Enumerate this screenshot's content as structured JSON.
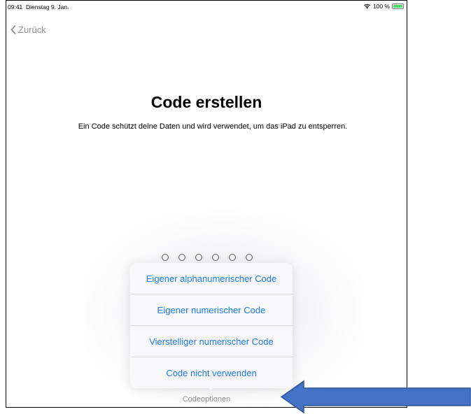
{
  "status_bar": {
    "time": "09:41",
    "date": "Dienstag 9. Jan.",
    "battery": "100 %",
    "battery_color": "#4cd964"
  },
  "nav": {
    "back_label": "Zurück",
    "back_icon": "chevron-left-icon"
  },
  "main": {
    "title": "Code erstellen",
    "subtitle": "Ein Code schützt deine Daten und wird verwendet, um das iPad zu entsperren.",
    "code_length": 6
  },
  "popup": {
    "items": [
      {
        "label": "Eigener alphanumerischer Code"
      },
      {
        "label": "Eigener numerischer Code"
      },
      {
        "label": "Vierstelliger numerischer Code"
      },
      {
        "label": "Code nicht verwenden"
      }
    ]
  },
  "footer": {
    "code_options_label": "Codeoptionen"
  },
  "annotation": {
    "arrow_color": "#4472c4",
    "arrow_icon": "left-arrow-icon"
  },
  "colors": {
    "link": "#1a7cf6",
    "muted": "#8e8e93"
  }
}
